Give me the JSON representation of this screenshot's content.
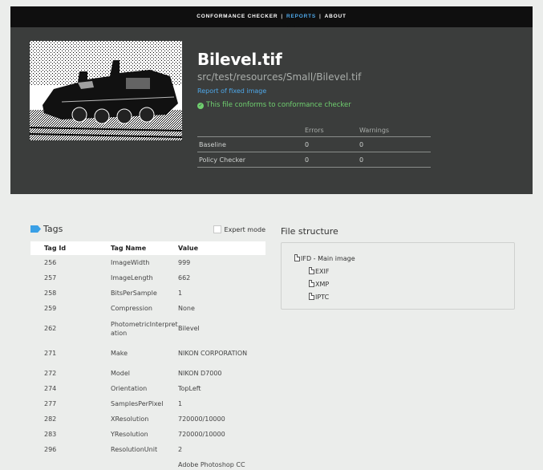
{
  "nav": {
    "items": [
      {
        "label": "CONFORMANCE CHECKER"
      },
      {
        "label": "REPORTS"
      },
      {
        "label": "ABOUT"
      }
    ],
    "separator": "|",
    "accent": "#4ea7e8"
  },
  "report": {
    "file_name": "Bilevel.tif",
    "file_path": "src/test/resources/Small/Bilevel.tif",
    "fixed_link": "Report of fixed image",
    "conformance_message": "This file conforms to conformance checker",
    "conformance_icon": "check-circle-icon",
    "success_color": "#6fcf6f"
  },
  "summary": {
    "headers": [
      "",
      "Errors",
      "Warnings"
    ],
    "rows": [
      {
        "name": "Baseline",
        "errors": "0",
        "warnings": "0"
      },
      {
        "name": "Policy Checker",
        "errors": "0",
        "warnings": "0"
      }
    ]
  },
  "tags": {
    "title": "Tags",
    "icon": "tag-icon",
    "expert_mode_label": "Expert mode",
    "expert_mode_checked": false,
    "columns": [
      "Tag Id",
      "Tag Name",
      "Value"
    ],
    "rows": [
      {
        "id": "256",
        "name": "ImageWidth",
        "value": "999"
      },
      {
        "id": "257",
        "name": "ImageLength",
        "value": "662"
      },
      {
        "id": "258",
        "name": "BitsPerSample",
        "value": "1"
      },
      {
        "id": "259",
        "name": "Compression",
        "value": "None"
      },
      {
        "id": "262",
        "name": "PhotometricInterpretation",
        "value": "Bilevel"
      },
      {
        "id": "271",
        "name": "Make",
        "value": "NIKON CORPORATION"
      },
      {
        "id": "272",
        "name": "Model",
        "value": "NIKON D7000"
      },
      {
        "id": "274",
        "name": "Orientation",
        "value": "TopLeft"
      },
      {
        "id": "277",
        "name": "SamplesPerPixel",
        "value": "1"
      },
      {
        "id": "282",
        "name": "XResolution",
        "value": "720000/10000"
      },
      {
        "id": "283",
        "name": "YResolution",
        "value": "720000/10000"
      },
      {
        "id": "296",
        "name": "ResolutionUnit",
        "value": "2"
      },
      {
        "id": "",
        "name": "",
        "value": "Adobe Photoshop CC"
      }
    ]
  },
  "file_structure": {
    "title": "File structure",
    "root": "IFD - Main image",
    "children": [
      "EXIF",
      "XMP",
      "IPTC"
    ]
  }
}
